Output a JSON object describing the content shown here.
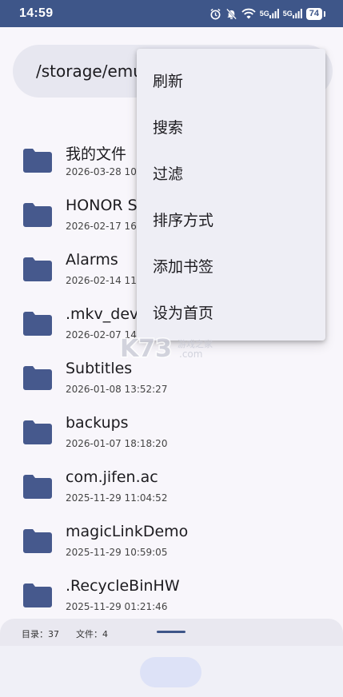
{
  "status_bar": {
    "time": "14:59",
    "icons": [
      "alarm-icon",
      "mute-icon",
      "wifi-icon",
      "signal-5g-icon",
      "signal-5g-icon-2"
    ],
    "signal_label_1": "5G",
    "signal_label_2": "5G",
    "battery": "74"
  },
  "path_bar": {
    "path": "/storage/emulated/0"
  },
  "files": [
    {
      "name": " 我的文件",
      "date": "2026-03-28 10:51:42"
    },
    {
      "name": "HONOR Share",
      "date": "2026-02-17 16:03:12"
    },
    {
      "name": "Alarms",
      "date": "2026-02-14 11:22:31"
    },
    {
      "name": ".mkv_device",
      "date": "2026-02-07 14:40:08"
    },
    {
      "name": "Subtitles",
      "date": "2026-01-08 13:52:27"
    },
    {
      "name": "backups",
      "date": "2026-01-07 18:18:20"
    },
    {
      "name": "com.jifen.ac",
      "date": "2025-11-29 11:04:52"
    },
    {
      "name": "magicLinkDemo",
      "date": "2025-11-29 10:59:05"
    },
    {
      "name": ".RecycleBinHW",
      "date": "2025-11-29 01:21:46"
    }
  ],
  "menu": {
    "items": [
      "刷新",
      "搜索",
      "过滤",
      "排序方式",
      "添加书签",
      "设为首页"
    ]
  },
  "watermark": {
    "text": "游戏之家"
  },
  "bottom_bar": {
    "dirs": "目录：37",
    "files": "文件：4"
  },
  "colors": {
    "accent": "#3e5689",
    "folder": "#46598d",
    "menu_bg": "#eeeef5",
    "path_bg": "#e7e7f0"
  }
}
